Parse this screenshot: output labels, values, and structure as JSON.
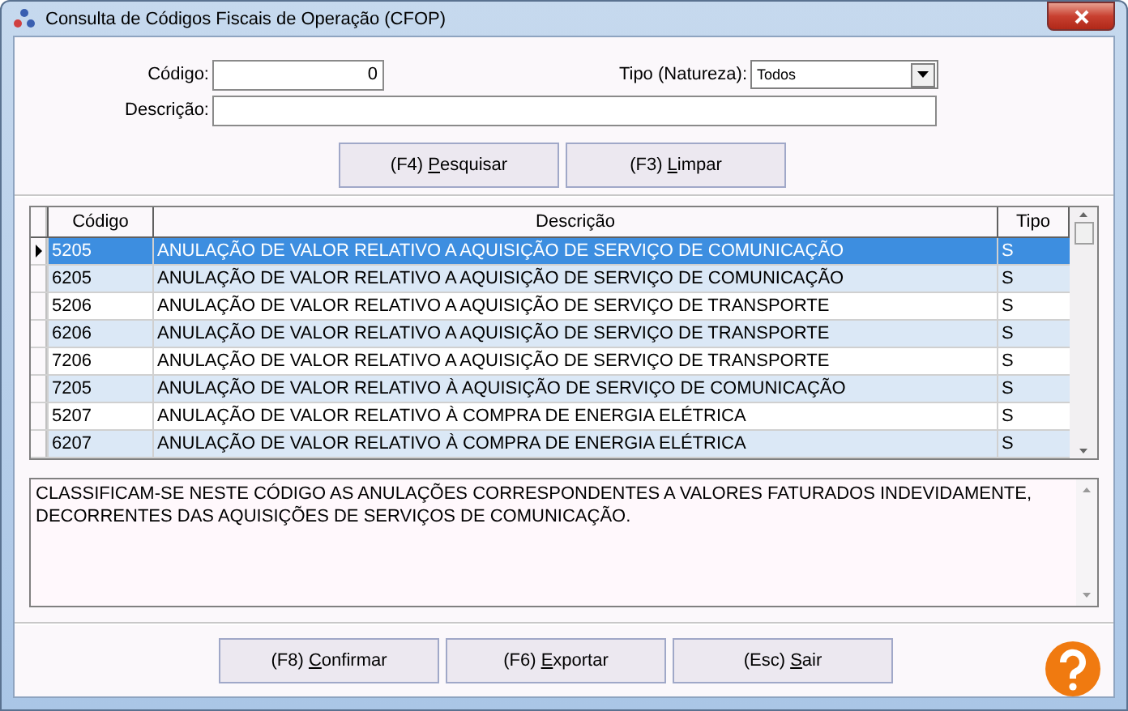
{
  "window": {
    "title": "Consulta de Códigos Fiscais de Operação (CFOP)"
  },
  "filters": {
    "codigo": {
      "label": "Código:",
      "value": "0"
    },
    "tipo": {
      "label": "Tipo (Natureza):",
      "value": "Todos"
    },
    "descricao": {
      "label": "Descrição:"
    }
  },
  "search_buttons": [
    {
      "before": "(F4) ",
      "key": "P",
      "after": "esquisar"
    },
    {
      "before": "(F3) ",
      "key": "L",
      "after": "impar"
    }
  ],
  "table": {
    "columns": [
      "Código",
      "Descrição",
      "Tipo"
    ],
    "rows": [
      {
        "codigo": "5205",
        "descricao": "ANULAÇÃO DE VALOR RELATIVO A AQUISIÇÃO DE SERVIÇO DE COMUNICAÇÃO",
        "tipo": "S",
        "selected": true
      },
      {
        "codigo": "6205",
        "descricao": "ANULAÇÃO DE VALOR RELATIVO A AQUISIÇÃO DE SERVIÇO DE COMUNICAÇÃO",
        "tipo": "S",
        "selected": false
      },
      {
        "codigo": "5206",
        "descricao": "ANULAÇÃO DE VALOR RELATIVO A AQUISIÇÃO DE SERVIÇO DE TRANSPORTE",
        "tipo": "S",
        "selected": false
      },
      {
        "codigo": "6206",
        "descricao": "ANULAÇÃO DE VALOR RELATIVO A AQUISIÇÃO DE SERVIÇO DE TRANSPORTE",
        "tipo": "S",
        "selected": false
      },
      {
        "codigo": "7206",
        "descricao": "ANULAÇÃO DE VALOR RELATIVO A AQUISIÇÃO DE SERVIÇO DE TRANSPORTE",
        "tipo": "S",
        "selected": false
      },
      {
        "codigo": "7205",
        "descricao": "ANULAÇÃO DE VALOR RELATIVO À AQUISIÇÃO DE SERVIÇO DE COMUNICAÇÃO",
        "tipo": "S",
        "selected": false
      },
      {
        "codigo": "5207",
        "descricao": "ANULAÇÃO DE VALOR RELATIVO À COMPRA DE ENERGIA ELÉTRICA",
        "tipo": "S",
        "selected": false
      },
      {
        "codigo": "6207",
        "descricao": "ANULAÇÃO DE VALOR RELATIVO À COMPRA DE ENERGIA ELÉTRICA",
        "tipo": "S",
        "selected": false
      }
    ]
  },
  "details": "CLASSIFICAM-SE NESTE CÓDIGO AS ANULAÇÕES CORRESPONDENTES A VALORES FATURADOS INDEVIDAMENTE, DECORRENTES DAS AQUISIÇÕES DE SERVIÇOS DE COMUNICAÇÃO.",
  "footer_buttons": [
    {
      "before": "(F8) ",
      "key": "C",
      "after": "onfirmar"
    },
    {
      "before": "(F6) ",
      "key": "E",
      "after": "xportar"
    },
    {
      "before": "(Esc) ",
      "key": "S",
      "after": "air"
    }
  ]
}
